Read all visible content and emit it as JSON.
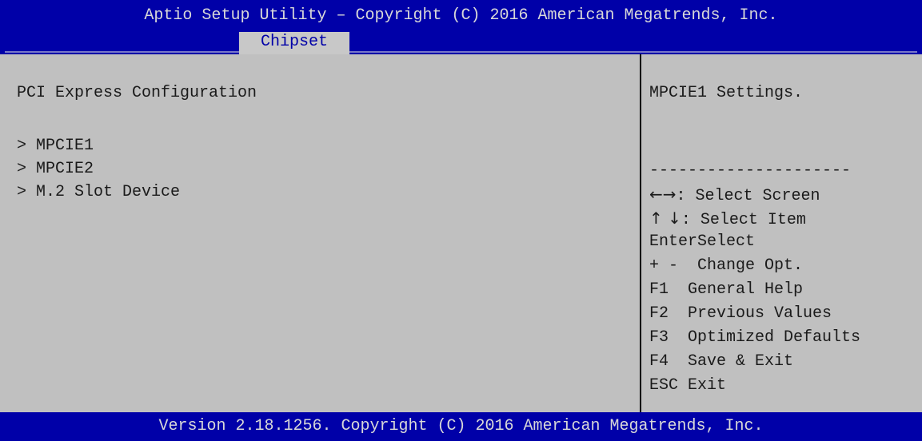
{
  "title": "Aptio Setup Utility – Copyright (C) 2016 American Megatrends, Inc.",
  "active_tab": "Chipset",
  "main": {
    "section_title": "PCI Express Configuration",
    "menu_items": [
      {
        "label": "> MPCIE1"
      },
      {
        "label": "> MPCIE2"
      },
      {
        "label": "> M.2 Slot Device"
      }
    ]
  },
  "help": {
    "description": "MPCIE1 Settings.",
    "separator": "---------------------",
    "keys": [
      {
        "key": "←→",
        "action": ": Select Screen"
      },
      {
        "key": "↑ ↓",
        "action": ": Select Item"
      },
      {
        "key": "Enter",
        "action": "Select"
      },
      {
        "key": "+ -",
        "action": "  Change Opt."
      },
      {
        "key": "F1",
        "action": "  General Help"
      },
      {
        "key": "F2",
        "action": "  Previous Values"
      },
      {
        "key": "F3",
        "action": "  Optimized Defaults"
      },
      {
        "key": "F4",
        "action": "  Save & Exit"
      },
      {
        "key": "ESC",
        "action": " Exit"
      }
    ]
  },
  "footer": "Version 2.18.1256. Copyright (C) 2016 American Megatrends, Inc.",
  "colors": {
    "bios_blue": "#0000a8",
    "panel_gray": "#c0c0c0",
    "header_text": "#d8d8d8"
  }
}
